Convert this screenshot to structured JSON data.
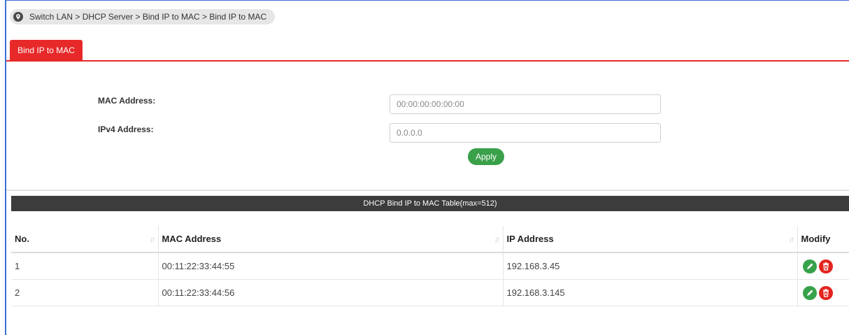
{
  "breadcrumb": {
    "text": "Switch LAN > DHCP Server > Bind IP to MAC  > Bind IP to MAC"
  },
  "tabs": [
    {
      "label": "Bind IP to MAC",
      "active": true
    }
  ],
  "form": {
    "mac_label": "MAC Address:",
    "mac_placeholder": "00:00:00:00:00:00",
    "ipv4_label": "IPv4 Address:",
    "ipv4_placeholder": "0.0.0.0",
    "apply_label": "Apply"
  },
  "table": {
    "title": "DHCP Bind IP to MAC Table(max=512)",
    "columns": [
      "No.",
      "MAC Address",
      "IP Address",
      "Modify"
    ],
    "rows": [
      {
        "no": "1",
        "mac": "00:11:22:33:44:55",
        "ip": "192.168.3.45"
      },
      {
        "no": "2",
        "mac": "00:11:22:33:44:56",
        "ip": "192.168.3.145"
      }
    ]
  },
  "colors": {
    "accent_red": "#e7292a",
    "apply_green": "#3aa04a",
    "table_header_dark": "#3c3c3c",
    "edit_green": "#36a24a",
    "delete_red": "#e3241f"
  },
  "icons": {
    "breadcrumb": "location-pin-icon",
    "sort": "sort-icon",
    "edit": "edit-icon",
    "delete": "delete-icon"
  }
}
